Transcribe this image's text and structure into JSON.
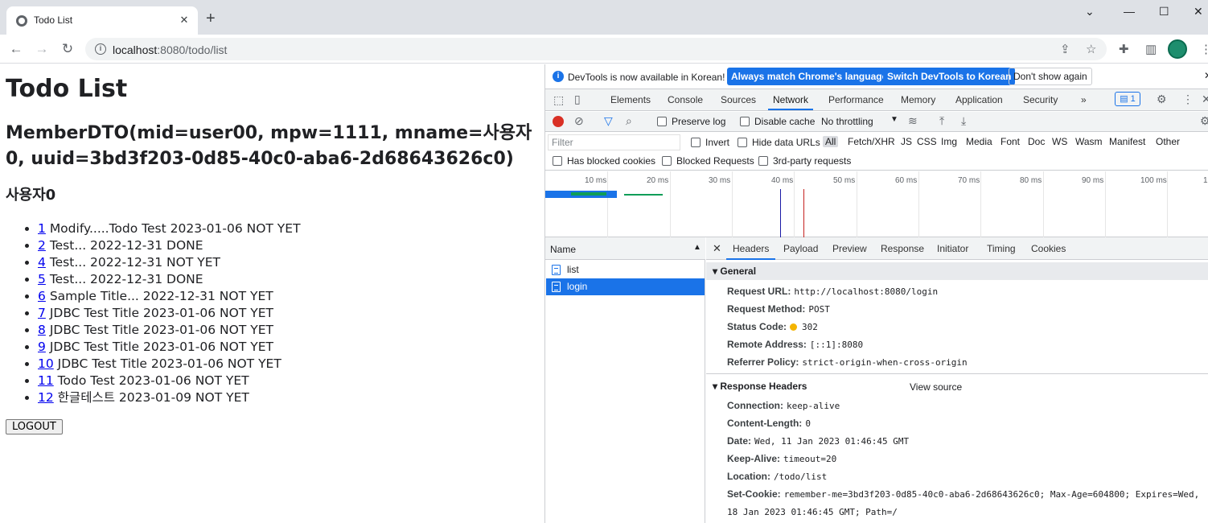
{
  "browser": {
    "tab_title": "Todo List",
    "url_host": "localhost",
    "url_rest": ":8080/todo/list"
  },
  "page": {
    "title": "Todo List",
    "member_dto": "MemberDTO(mid=user00, mpw=1111, mname=사용자0, uuid=3bd3f203-0d85-40c0-aba6-2d68643626c0)",
    "username": "사용자0",
    "todos": [
      {
        "tno": "1",
        "text": "Modify.....Todo Test 2023-01-06 NOT YET"
      },
      {
        "tno": "2",
        "text": "Test... 2022-12-31 DONE"
      },
      {
        "tno": "4",
        "text": "Test... 2022-12-31 NOT YET"
      },
      {
        "tno": "5",
        "text": "Test... 2022-12-31 DONE"
      },
      {
        "tno": "6",
        "text": "Sample Title... 2022-12-31 NOT YET"
      },
      {
        "tno": "7",
        "text": "JDBC Test Title 2023-01-06 NOT YET"
      },
      {
        "tno": "8",
        "text": "JDBC Test Title 2023-01-06 NOT YET"
      },
      {
        "tno": "9",
        "text": "JDBC Test Title 2023-01-06 NOT YET"
      },
      {
        "tno": "10",
        "text": "JDBC Test Title 2023-01-06 NOT YET"
      },
      {
        "tno": "11",
        "text": "Todo Test 2023-01-06 NOT YET"
      },
      {
        "tno": "12",
        "text": "한글테스트 2023-01-09 NOT YET"
      }
    ],
    "logout_label": "LOGOUT"
  },
  "devtools": {
    "infobar": {
      "message": "DevTools is now available in Korean!",
      "match_btn": "Always match Chrome's language",
      "switch_btn": "Switch DevTools to Korean",
      "dismiss_btn": "Don't show again"
    },
    "tabs": [
      "Elements",
      "Console",
      "Sources",
      "Network",
      "Performance",
      "Memory",
      "Application",
      "Security"
    ],
    "active_tab": "Network",
    "more": "»",
    "issues_count": "1",
    "network_toolbar": {
      "preserve_log": "Preserve log",
      "disable_cache": "Disable cache",
      "throttling": "No throttling"
    },
    "filter": {
      "placeholder": "Filter",
      "invert": "Invert",
      "hide_data_urls": "Hide data URLs",
      "types": [
        "All",
        "Fetch/XHR",
        "JS",
        "CSS",
        "Img",
        "Media",
        "Font",
        "Doc",
        "WS",
        "Wasm",
        "Manifest",
        "Other"
      ],
      "has_blocked": "Has blocked cookies",
      "blocked_requests": "Blocked Requests",
      "third_party": "3rd-party requests"
    },
    "timeline_ticks": [
      "10 ms",
      "20 ms",
      "30 ms",
      "40 ms",
      "50 ms",
      "60 ms",
      "70 ms",
      "80 ms",
      "90 ms",
      "100 ms",
      "1"
    ],
    "requests": {
      "header": "Name",
      "items": [
        "list",
        "login"
      ],
      "selected": "login"
    },
    "details": {
      "tabs": [
        "Headers",
        "Payload",
        "Preview",
        "Response",
        "Initiator",
        "Timing",
        "Cookies"
      ],
      "active_tab": "Headers",
      "general_title": "General",
      "general": [
        {
          "k": "Request URL:",
          "v": "http://localhost:8080/login"
        },
        {
          "k": "Request Method:",
          "v": "POST"
        },
        {
          "k": "Status Code:",
          "v": "302"
        },
        {
          "k": "Remote Address:",
          "v": "[::1]:8080"
        },
        {
          "k": "Referrer Policy:",
          "v": "strict-origin-when-cross-origin"
        }
      ],
      "response_title": "Response Headers",
      "view_source": "View source",
      "response": [
        {
          "k": "Connection:",
          "v": "keep-alive"
        },
        {
          "k": "Content-Length:",
          "v": "0"
        },
        {
          "k": "Date:",
          "v": "Wed, 11 Jan 2023 01:46:45 GMT"
        },
        {
          "k": "Keep-Alive:",
          "v": "timeout=20"
        },
        {
          "k": "Location:",
          "v": "/todo/list"
        },
        {
          "k": "Set-Cookie:",
          "v": "remember-me=3bd3f203-0d85-40c0-aba6-2d68643626c0; Max-Age=604800; Expires=Wed,"
        },
        {
          "k": "",
          "v": "18 Jan 2023 01:46:45 GMT; Path=/"
        }
      ]
    }
  }
}
